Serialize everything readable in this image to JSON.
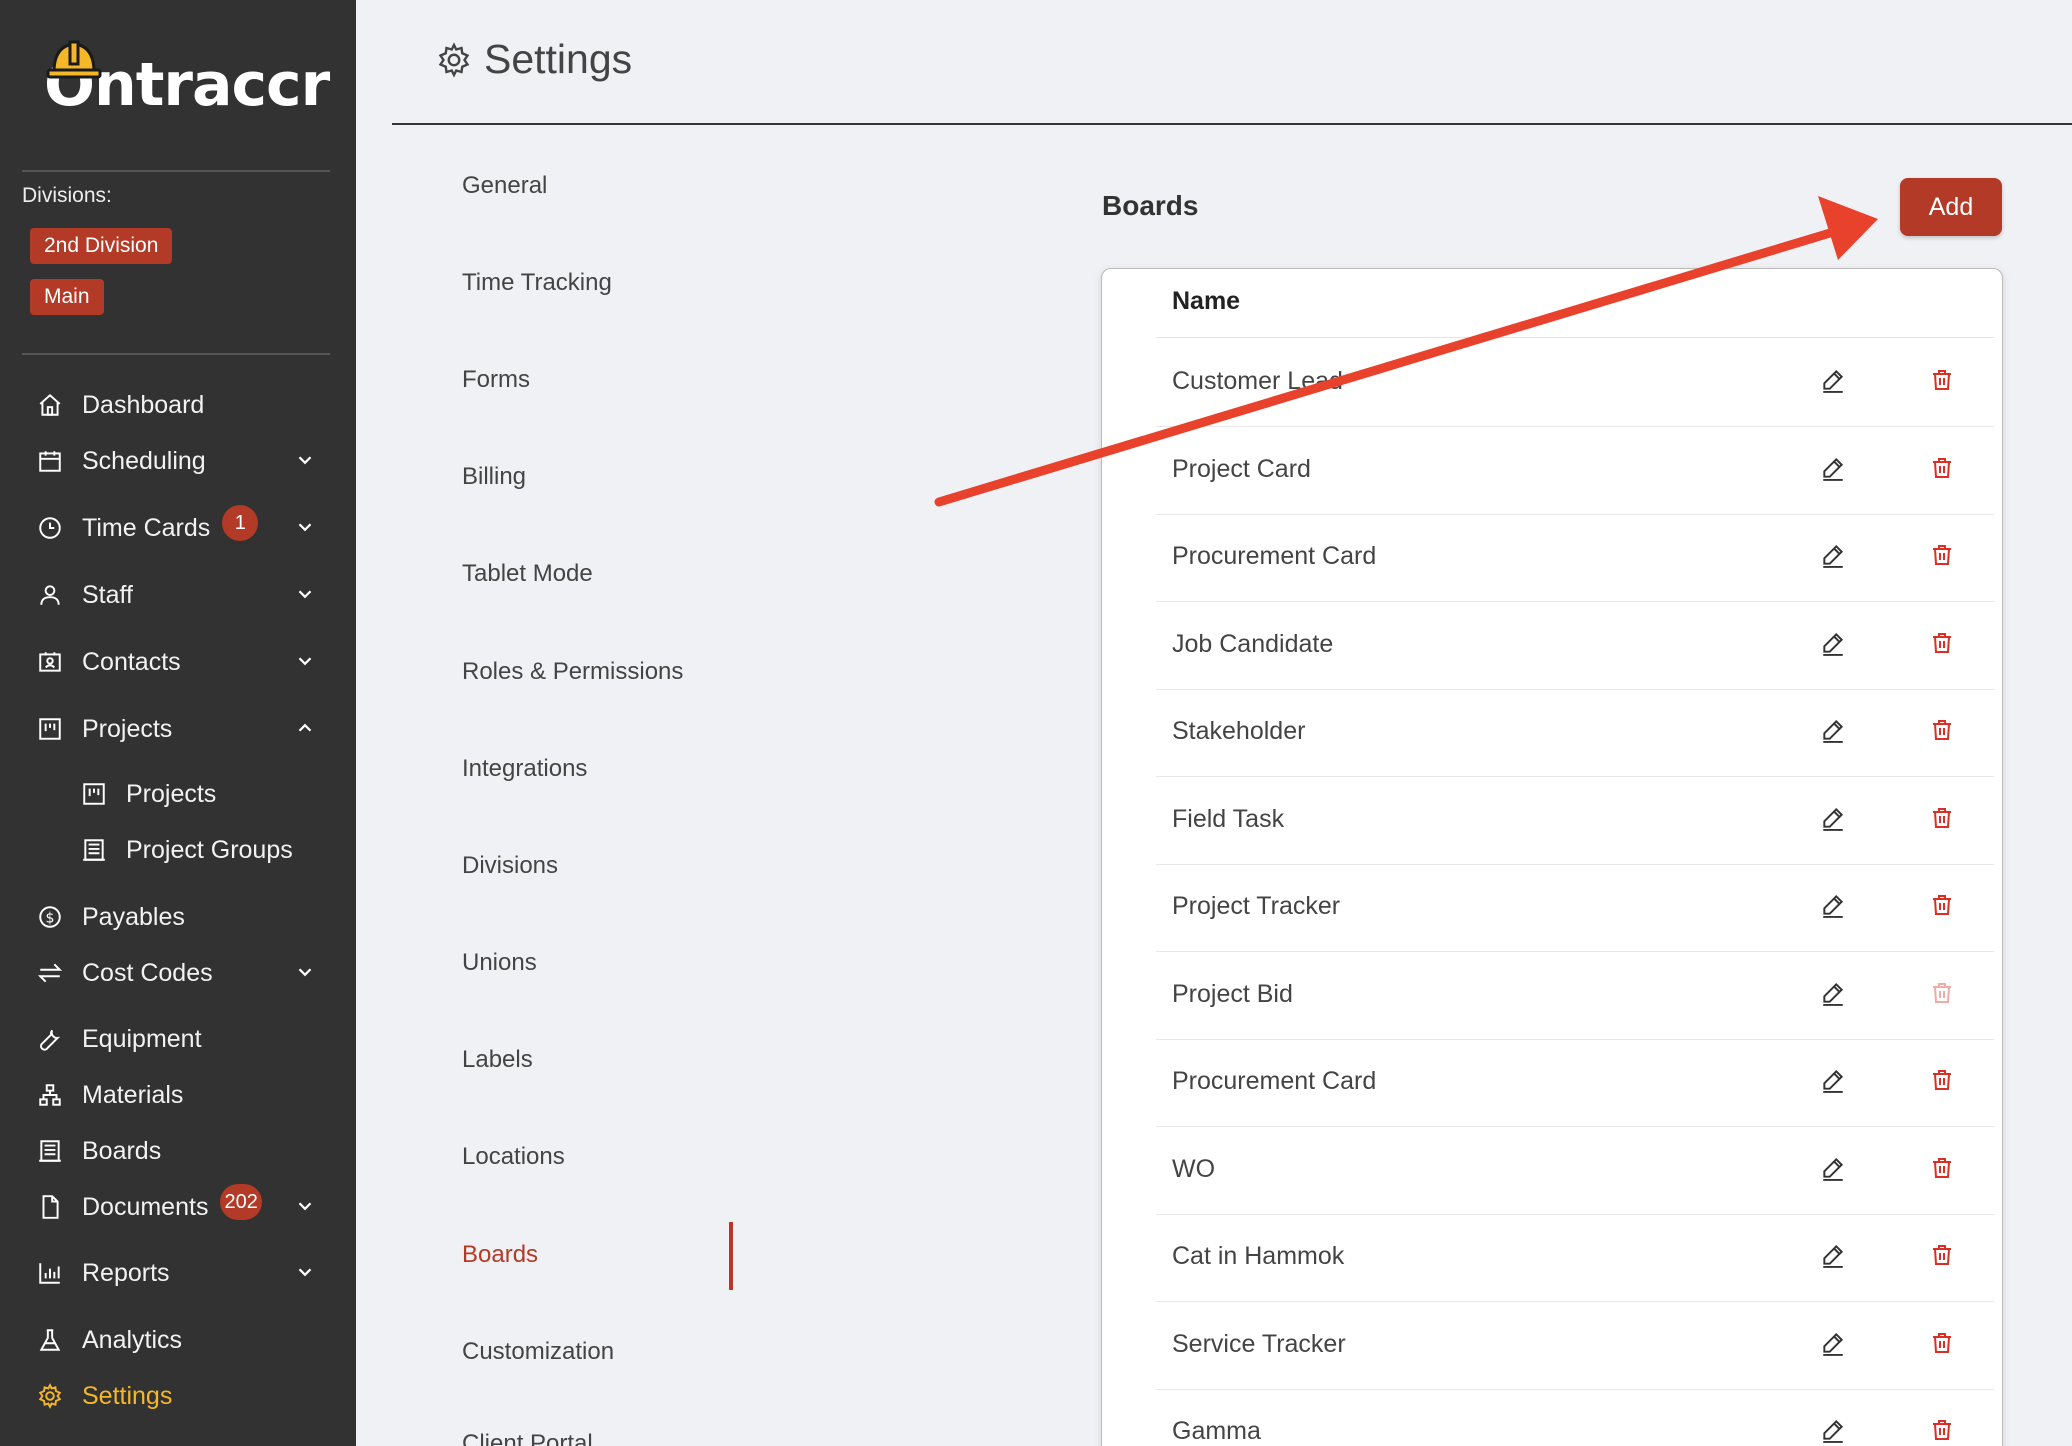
{
  "brand": {
    "logo_text": "Ontraccr"
  },
  "divisions": {
    "label": "Divisions:",
    "items": [
      "2nd Division",
      "Main"
    ]
  },
  "sidebar": {
    "items": [
      {
        "label": "Dashboard",
        "icon": "home-icon"
      },
      {
        "label": "Scheduling",
        "icon": "calendar-icon"
      },
      {
        "label": "Time Cards",
        "icon": "clock-icon",
        "badge": "1"
      },
      {
        "label": "Staff",
        "icon": "user-icon"
      },
      {
        "label": "Contacts",
        "icon": "contact-card-icon"
      },
      {
        "label": "Projects",
        "icon": "project-icon"
      },
      {
        "label": "Projects",
        "icon": "project-icon"
      },
      {
        "label": "Project Groups",
        "icon": "project-group-icon"
      },
      {
        "label": "Payables",
        "icon": "dollar-icon"
      },
      {
        "label": "Cost Codes",
        "icon": "swap-icon"
      },
      {
        "label": "Equipment",
        "icon": "wrench-icon"
      },
      {
        "label": "Materials",
        "icon": "cluster-icon"
      },
      {
        "label": "Boards",
        "icon": "board-icon"
      },
      {
        "label": "Documents",
        "icon": "document-icon",
        "badge": "202"
      },
      {
        "label": "Reports",
        "icon": "bar-chart-icon"
      },
      {
        "label": "Analytics",
        "icon": "flask-icon"
      },
      {
        "label": "Settings",
        "icon": "gear-icon"
      }
    ]
  },
  "header": {
    "title": "Settings"
  },
  "settings_menu": {
    "items": [
      "General",
      "Time Tracking",
      "Forms",
      "Billing",
      "Tablet Mode",
      "Roles & Permissions",
      "Integrations",
      "Divisions",
      "Unions",
      "Labels",
      "Locations",
      "Boards",
      "Customization",
      "Client Portal"
    ],
    "active": "Boards"
  },
  "boards": {
    "title": "Boards",
    "add_label": "Add",
    "column_name": "Name",
    "rows": [
      "Customer Lead",
      "Project Card",
      "Procurement Card",
      "Job Candidate",
      "Stakeholder",
      "Field Task",
      "Project Tracker",
      "Project Bid",
      "Procurement Card",
      "WO",
      "Cat in Hammok",
      "Service Tracker",
      "Gamma"
    ]
  },
  "colors": {
    "sidebar_bg": "#323232",
    "accent": "#b33a26",
    "active_nav": "#f4b72a",
    "page_bg": "#f0f1f5",
    "arrow": "#e8412c"
  }
}
